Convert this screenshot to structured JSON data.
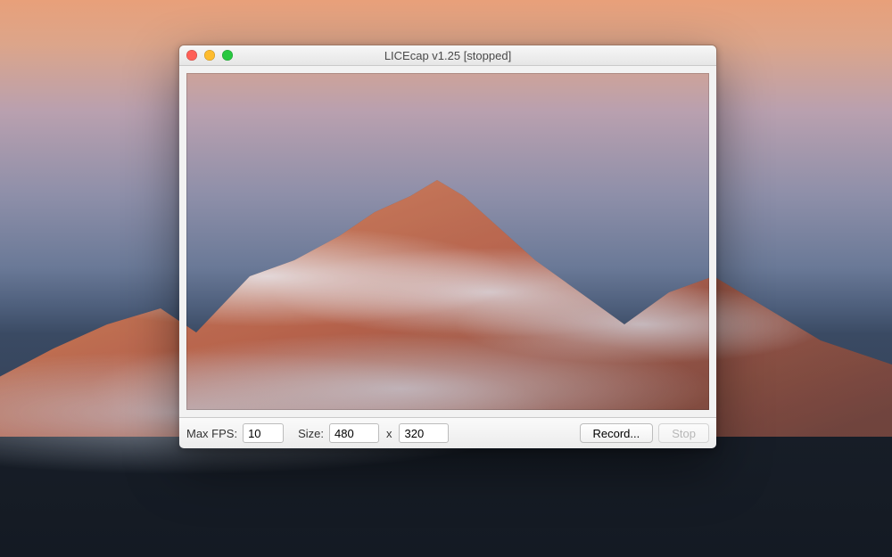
{
  "window": {
    "title": "LICEcap v1.25 [stopped]",
    "traffic_light_colors": {
      "close": "#ff5f57",
      "minimize": "#febc2e",
      "zoom": "#28c840"
    }
  },
  "controls": {
    "max_fps_label": "Max FPS:",
    "max_fps_value": "10",
    "size_label": "Size:",
    "size_width": "480",
    "size_height": "320",
    "size_separator": "x",
    "record_label": "Record...",
    "stop_label": "Stop",
    "stop_enabled": false
  }
}
